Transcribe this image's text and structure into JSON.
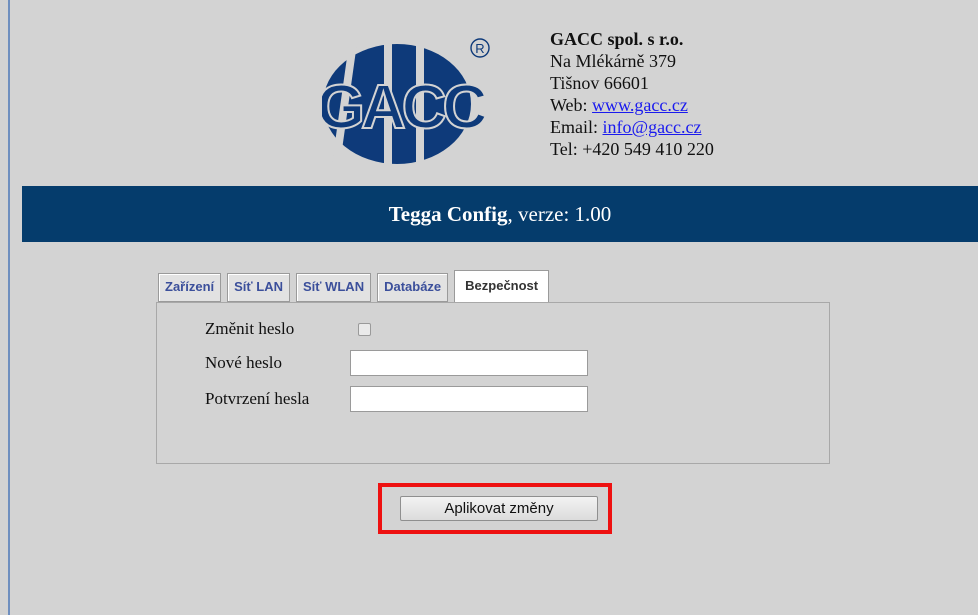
{
  "company": {
    "logo_text": "GACC",
    "registered_mark": "®",
    "name": "GACC spol. s r.o.",
    "street": "Na Mlékárně 379",
    "city": "Tišnov 66601",
    "web_label": "Web: ",
    "web_link": "www.gacc.cz",
    "email_label": "Email: ",
    "email_link": "info@gacc.cz",
    "phone": "Tel: +420 549 410 220"
  },
  "titlebar": {
    "app_name": "Tegga Config",
    "version_text": ", verze: 1.00"
  },
  "tabs": [
    {
      "label": "Zařízení",
      "active": false
    },
    {
      "label": "Síť LAN",
      "active": false
    },
    {
      "label": "Síť WLAN",
      "active": false
    },
    {
      "label": "Databáze",
      "active": false
    },
    {
      "label": "Bezpečnost",
      "active": true
    }
  ],
  "security_form": {
    "change_password_label": "Změnit heslo",
    "change_password_checked": false,
    "new_password_label": "Nové heslo",
    "new_password_value": "",
    "confirm_password_label": "Potvrzení hesla",
    "confirm_password_value": ""
  },
  "apply_button": "Aplikovat změny",
  "colors": {
    "background": "#d3d3d3",
    "titlebar": "#053c6c",
    "logo": "#0e3a7a",
    "tab_text": "#3b4f9b",
    "highlight": "#ee1111"
  }
}
